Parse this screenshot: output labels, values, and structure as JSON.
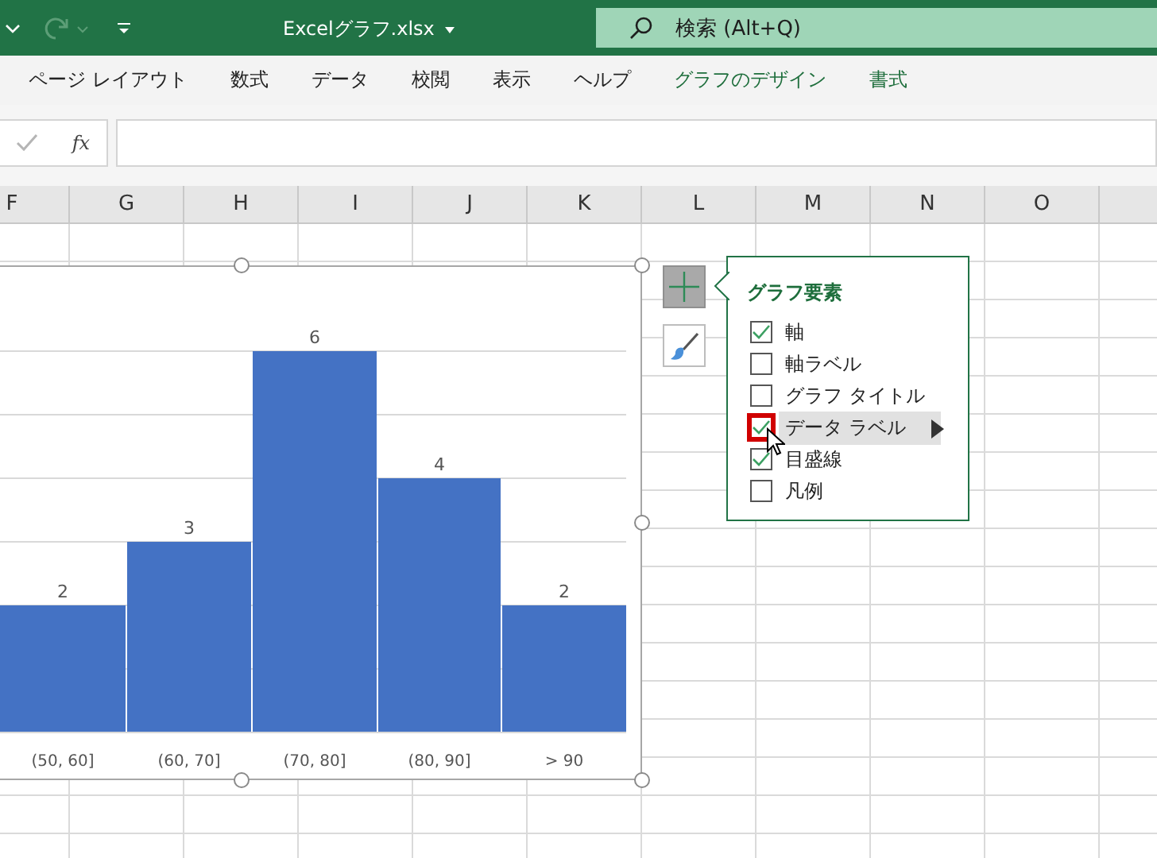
{
  "title_bar": {
    "file_name": "Excelグラフ.xlsx",
    "search_placeholder": "検索 (Alt+Q)"
  },
  "ribbon_tabs": [
    {
      "label": "ページ レイアウト",
      "contextual": false
    },
    {
      "label": "数式",
      "contextual": false
    },
    {
      "label": "データ",
      "contextual": false
    },
    {
      "label": "校閲",
      "contextual": false
    },
    {
      "label": "表示",
      "contextual": false
    },
    {
      "label": "ヘルプ",
      "contextual": false
    },
    {
      "label": "グラフのデザイン",
      "contextual": true
    },
    {
      "label": "書式",
      "contextual": true
    }
  ],
  "formula_bar": {
    "function_label": "fx"
  },
  "columns": [
    "F",
    "G",
    "H",
    "I",
    "J",
    "K",
    "L",
    "M",
    "N",
    "O"
  ],
  "chart": {
    "chart_data": {
      "type": "bar",
      "categories": [
        "(50, 60]",
        "(60, 70]",
        "(70, 80]",
        "(80, 90]",
        "> 90"
      ],
      "values": [
        2,
        3,
        6,
        4,
        2
      ],
      "data_labels": true
    }
  },
  "chart_elements_panel": {
    "title": "グラフ要素",
    "items": [
      {
        "label": "軸",
        "checked": true,
        "selected": false
      },
      {
        "label": "軸ラベル",
        "checked": false,
        "selected": false
      },
      {
        "label": "グラフ タイトル",
        "checked": false,
        "selected": false
      },
      {
        "label": "データ ラベル",
        "checked": true,
        "selected": true
      },
      {
        "label": "目盛線",
        "checked": true,
        "selected": false
      },
      {
        "label": "凡例",
        "checked": false,
        "selected": false
      }
    ]
  }
}
